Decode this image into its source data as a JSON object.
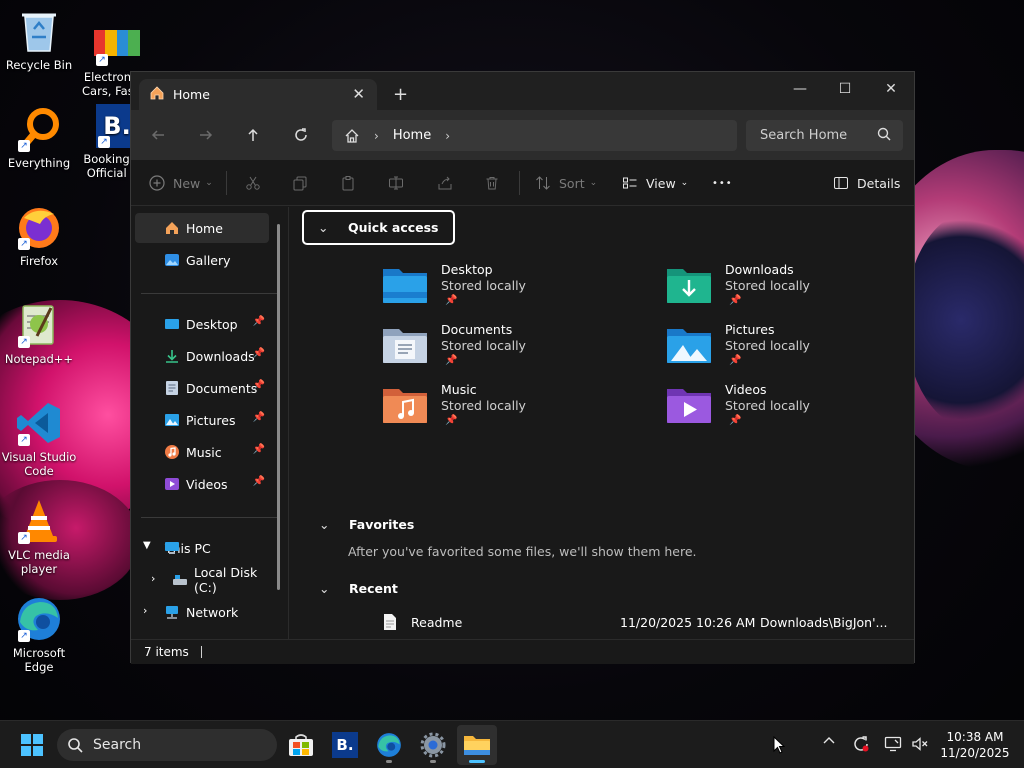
{
  "desktop": {
    "icons": [
      {
        "label": "Recycle Bin"
      },
      {
        "label": "Electronics, Cars, Fash..."
      },
      {
        "label": "Everything"
      },
      {
        "label": "Booking.c... Official s..."
      },
      {
        "label": "Firefox"
      },
      {
        "label": "Notepad++"
      },
      {
        "label": "Visual Studio Code"
      },
      {
        "label": "VLC media player"
      },
      {
        "label": "Microsoft Edge"
      }
    ],
    "booking_glyph": "B."
  },
  "window": {
    "tab_title": "Home",
    "close_glyph": "✕",
    "newtab_glyph": "+",
    "controls": {
      "minimize": "—",
      "maximize": "☐",
      "close": "✕"
    },
    "address_crumb": "Home",
    "search_placeholder": "Search Home",
    "toolbar": {
      "new_label": "New",
      "sort_label": "Sort",
      "view_label": "View",
      "more_glyph": "•••",
      "details_label": "Details"
    },
    "sidebar": {
      "top": [
        {
          "label": "Home"
        },
        {
          "label": "Gallery"
        }
      ],
      "pinned": [
        {
          "label": "Desktop"
        },
        {
          "label": "Downloads"
        },
        {
          "label": "Documents"
        },
        {
          "label": "Pictures"
        },
        {
          "label": "Music"
        },
        {
          "label": "Videos"
        }
      ],
      "tree": [
        {
          "label": "This PC"
        },
        {
          "label": "Local Disk (C:)"
        },
        {
          "label": "Network"
        }
      ]
    },
    "quick_access": {
      "header": "Quick access",
      "folders": [
        {
          "name": "Desktop",
          "status": "Stored locally"
        },
        {
          "name": "Downloads",
          "status": "Stored locally"
        },
        {
          "name": "Documents",
          "status": "Stored locally"
        },
        {
          "name": "Pictures",
          "status": "Stored locally"
        },
        {
          "name": "Music",
          "status": "Stored locally"
        },
        {
          "name": "Videos",
          "status": "Stored locally"
        }
      ]
    },
    "favorites": {
      "header": "Favorites",
      "empty_note": "After you've favorited some files, we'll show them here."
    },
    "recent": {
      "header": "Recent",
      "items": [
        {
          "name": "Readme",
          "date": "11/20/2025 10:26 AM",
          "location": "Downloads\\BigJon'..."
        }
      ]
    },
    "status": "7 items"
  },
  "taskbar": {
    "search_placeholder": "Search",
    "booking_glyph": "B.",
    "clock_time": "10:38 AM",
    "clock_date": "11/20/2025"
  },
  "colors": {
    "accent": "#0078d4",
    "folder_blue": "#2aa1e8",
    "downloads_green": "#1fb58f",
    "music_orange": "#f07b45",
    "videos_purple": "#8e4bd6"
  }
}
